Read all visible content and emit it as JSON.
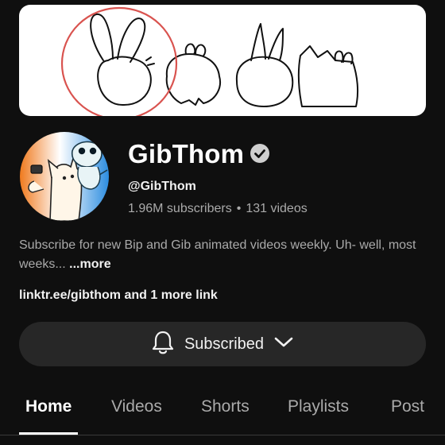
{
  "channel": {
    "name": "GibThom",
    "handle": "@GibThom",
    "subscribers": "1.96M subscribers",
    "separator": "•",
    "videos": "131 videos",
    "description": "Subscribe for new Bip and Gib animated videos weekly. Uh- well, most weeks...",
    "more_label": "...more",
    "links": {
      "url": "linktr.ee/gibthom",
      "suffix": " and 1 more link"
    }
  },
  "subscribe_button": {
    "label": "Subscribed",
    "icon": "bell-icon",
    "dropdown_icon": "chevron-down-icon"
  },
  "tabs": [
    {
      "label": "Home",
      "active": true
    },
    {
      "label": "Videos",
      "active": false
    },
    {
      "label": "Shorts",
      "active": false
    },
    {
      "label": "Playlists",
      "active": false
    },
    {
      "label": "Post",
      "active": false
    }
  ],
  "colors": {
    "background": "#0f0f0f",
    "button": "#272727",
    "secondary_text": "#aaaaaa",
    "banner_circle": "#d9534f"
  }
}
